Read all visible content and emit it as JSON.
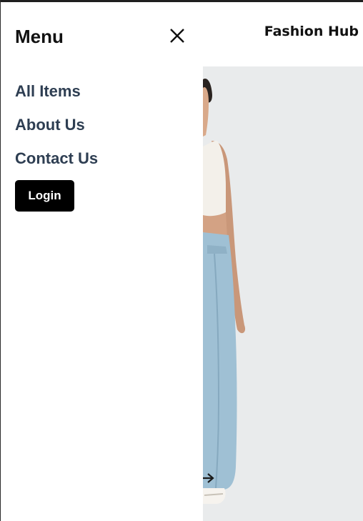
{
  "header": {
    "brand": "Fashion Hub"
  },
  "menu": {
    "title": "Menu",
    "close_icon": "close-icon",
    "items": [
      {
        "label": "All Items"
      },
      {
        "label": "About Us"
      },
      {
        "label": "Contact Us"
      }
    ],
    "login_label": "Login"
  },
  "hero": {
    "carousel_next_icon": "arrow-right-icon"
  },
  "colors": {
    "nav_text": "#2e3e52",
    "button_bg": "#000000",
    "hero_bg": "#e9ebec"
  }
}
